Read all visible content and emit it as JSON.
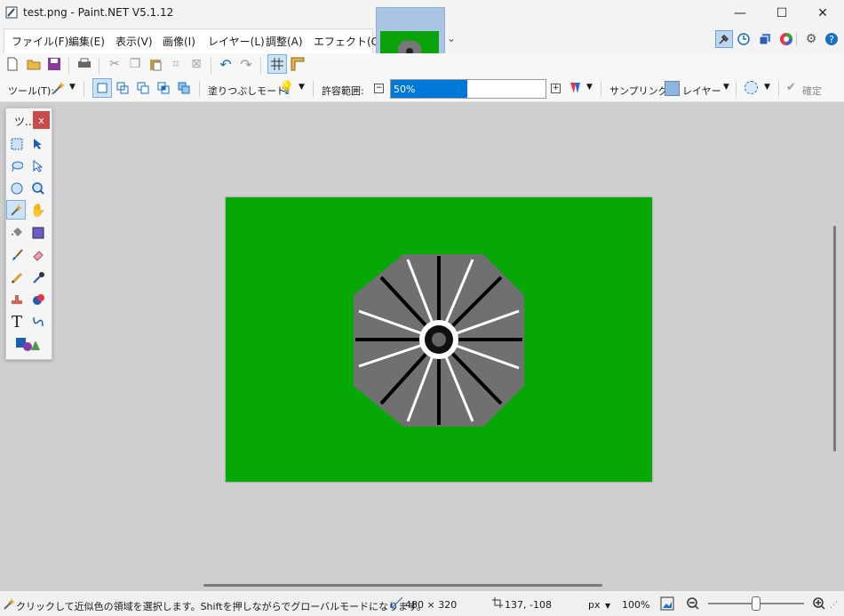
{
  "window": {
    "title": "test.png - Paint.NET V5.1.12",
    "minimize_glyph": "—",
    "maximize_glyph": "☐",
    "close_glyph": "✕"
  },
  "menu": {
    "items": [
      "ファイル(F)",
      "編集(E)",
      "表示(V)",
      "画像(I)",
      "レイヤー(L)",
      "調整(A)",
      "エフェクト(C)"
    ],
    "overflow_glyph": "⌄"
  },
  "right_icons": [
    "tools-window-icon",
    "history-icon",
    "layers-icon",
    "colors-icon",
    "settings-icon",
    "help-icon"
  ],
  "toolbar2": {
    "tool_label": "ツール(T):",
    "fill_mode_label": "塗りつぶしモード:",
    "tolerance_label": "許容範囲:",
    "tolerance_value": "50%",
    "tolerance_fraction": 0.5,
    "sampling_label": "サンプリング:",
    "sampling_value": "レイヤー",
    "finish_label": "確定"
  },
  "tools_panel": {
    "title": "ツ...",
    "close": "x"
  },
  "status": {
    "hint": "クリックして近似色の領域を選択します。Shiftを押しながらでグローバルモードになります。",
    "image_size": "480 × 320",
    "cursor_pos": "137, -108",
    "unit": "px",
    "zoom": "100%"
  },
  "colors": {
    "canvas_bg": "#05a805",
    "accent": "#0078d7"
  }
}
